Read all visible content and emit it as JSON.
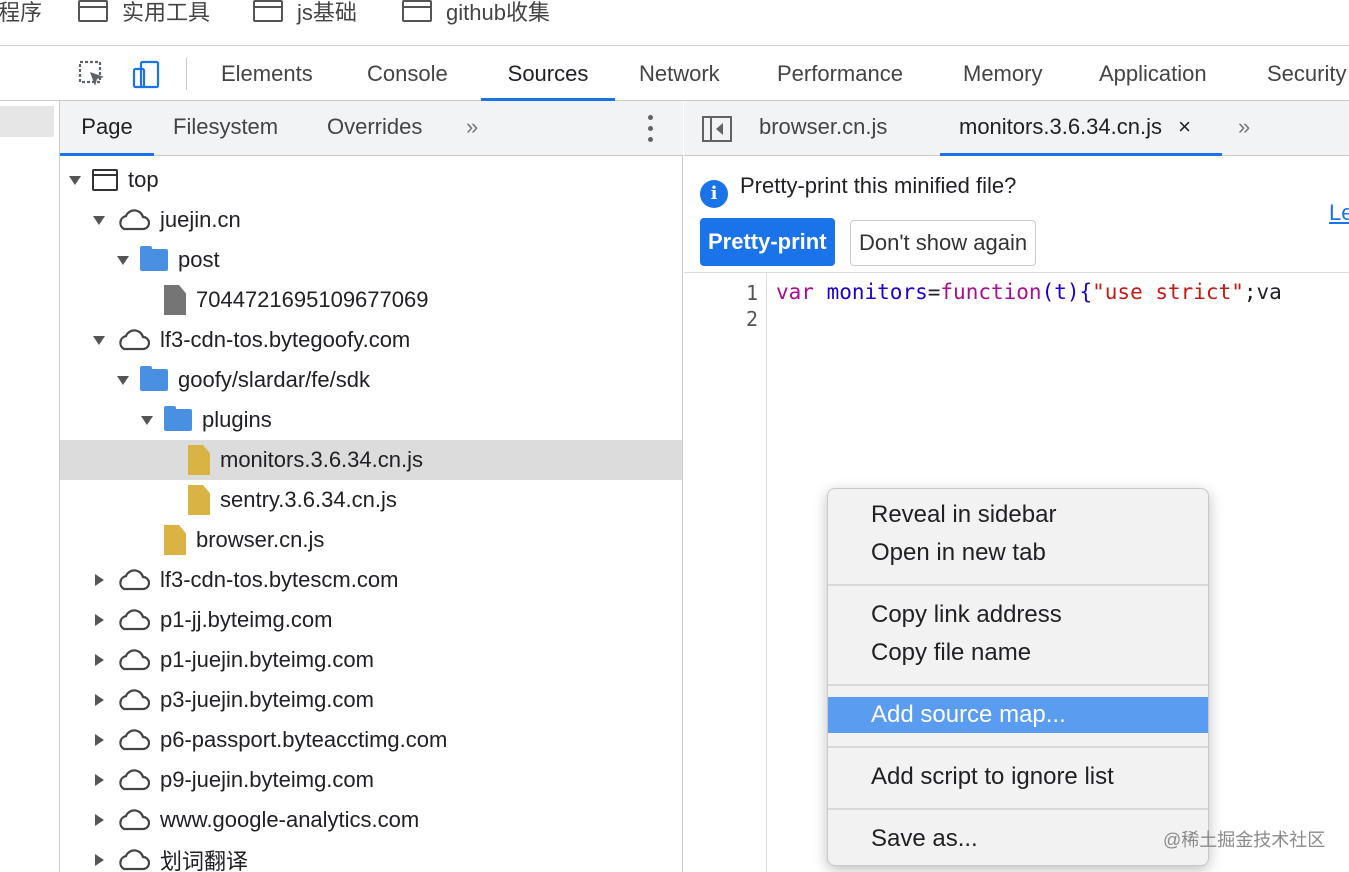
{
  "bookmarks": {
    "first_partial": "程序",
    "items": [
      "实用工具",
      "js基础",
      "github收集"
    ]
  },
  "toolbar": {
    "tabs": [
      "Elements",
      "Console",
      "Sources",
      "Network",
      "Performance",
      "Memory",
      "Application",
      "Security"
    ],
    "active_tab": "Sources"
  },
  "navigator": {
    "tabs": [
      "Page",
      "Filesystem",
      "Overrides"
    ],
    "active_tab": "Page",
    "more_label": "»",
    "tree": [
      {
        "label": "top",
        "icon": "frame-icon",
        "expanded": true
      },
      {
        "label": "juejin.cn",
        "icon": "cloud-icon",
        "expanded": true
      },
      {
        "label": "post",
        "icon": "folder-icon",
        "expanded": true
      },
      {
        "label": "7044721695109677069",
        "icon": "file-icon"
      },
      {
        "label": "lf3-cdn-tos.bytegoofy.com",
        "icon": "cloud-icon",
        "expanded": true
      },
      {
        "label": "goofy/slardar/fe/sdk",
        "icon": "folder-icon",
        "expanded": true
      },
      {
        "label": "plugins",
        "icon": "folder-icon",
        "expanded": true
      },
      {
        "label": "monitors.3.6.34.cn.js",
        "icon": "js-file-icon",
        "selected": true
      },
      {
        "label": "sentry.3.6.34.cn.js",
        "icon": "js-file-icon"
      },
      {
        "label": "browser.cn.js",
        "icon": "js-file-icon"
      },
      {
        "label": "lf3-cdn-tos.bytescm.com",
        "icon": "cloud-icon",
        "expanded": false
      },
      {
        "label": "p1-jj.byteimg.com",
        "icon": "cloud-icon",
        "expanded": false
      },
      {
        "label": "p1-juejin.byteimg.com",
        "icon": "cloud-icon",
        "expanded": false
      },
      {
        "label": "p3-juejin.byteimg.com",
        "icon": "cloud-icon",
        "expanded": false
      },
      {
        "label": "p6-passport.byteacctimg.com",
        "icon": "cloud-icon",
        "expanded": false
      },
      {
        "label": "p9-juejin.byteimg.com",
        "icon": "cloud-icon",
        "expanded": false
      },
      {
        "label": "www.google-analytics.com",
        "icon": "cloud-icon",
        "expanded": false
      },
      {
        "label": "划词翻译",
        "icon": "cloud-icon",
        "expanded": false
      }
    ]
  },
  "editor": {
    "tabs": [
      "browser.cn.js",
      "monitors.3.6.34.cn.js"
    ],
    "active_tab": "monitors.3.6.34.cn.js",
    "close_label": "×",
    "more_label": "»",
    "infobar": {
      "message": "Pretty-print this minified file?",
      "primary_button": "Pretty-print",
      "secondary_button": "Don't show again",
      "link_partial": "Le"
    },
    "line_numbers": [
      "1",
      "2"
    ],
    "code": {
      "kw_var": "var",
      "ident": "monitors",
      "eq": "=",
      "kw_function": "function",
      "args": "(t){",
      "string": "\"use strict\"",
      "tail": ";va"
    }
  },
  "context_menu": {
    "items": [
      "Reveal in sidebar",
      "Open in new tab",
      "Copy link address",
      "Copy file name",
      "Add source map...",
      "Add script to ignore list",
      "Save as..."
    ],
    "highlighted": "Add source map..."
  },
  "watermark": "@稀土掘金技术社区",
  "colors": {
    "accent": "#1a73e8",
    "menu_highlight": "#5a9cf0",
    "js_file": "#d9b445",
    "folder": "#4a90e2"
  }
}
